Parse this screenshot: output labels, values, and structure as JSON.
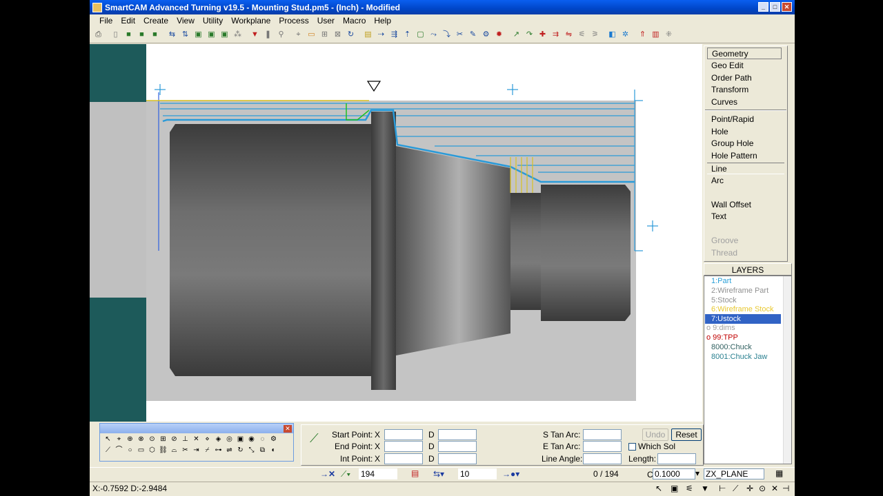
{
  "window": {
    "title": "SmartCAM Advanced Turning v19.5 - Mounting Stud.pm5 - (Inch) - Modified",
    "min": "_",
    "max": "□",
    "close": "✕"
  },
  "menu": [
    "File",
    "Edit",
    "Create",
    "View",
    "Utility",
    "Workplane",
    "Process",
    "User",
    "Macro",
    "Help"
  ],
  "commands": {
    "group1": [
      "Geometry",
      "Geo Edit",
      "Order Path",
      "Transform",
      "Curves"
    ],
    "group2": [
      "Point/Rapid",
      "Hole",
      "Group Hole",
      "Hole Pattern",
      "Line",
      "Arc"
    ],
    "group3": [
      "Wall Offset",
      "Text"
    ],
    "group4": [
      "Groove",
      "Thread"
    ]
  },
  "layers": {
    "header": "LAYERS",
    "items": [
      {
        "label": "1:Part",
        "color": "#2aa0d8"
      },
      {
        "label": "2:Wireframe Part",
        "color": "#909090"
      },
      {
        "label": "5:Stock",
        "color": "#909090"
      },
      {
        "label": "6:Wireframe Stock",
        "color": "#e8c830"
      },
      {
        "label": "7:Ustock",
        "color": "#ffffff",
        "selected": true
      },
      {
        "label": "o 9:dims",
        "color": "#a0a0a0"
      },
      {
        "label": "o 99:TPP",
        "color": "#c00000"
      },
      {
        "label": "8000:Chuck",
        "color": "#306060"
      },
      {
        "label": "8001:Chuck Jaw",
        "color": "#2a8090"
      }
    ]
  },
  "form": {
    "start_point": "Start Point:",
    "end_point": "End Point:",
    "int_point": "Int Point:",
    "x": "X",
    "d": "D",
    "s_tan_arc": "S Tan Arc:",
    "e_tan_arc": "E Tan Arc:",
    "line_angle": "Line Angle:",
    "which_sol": "Which Sol",
    "length": "Length:",
    "undo": "Undo",
    "reset": "Reset"
  },
  "bottom": {
    "step_value": "194",
    "count_value": "10",
    "counter": "0 / 194",
    "c_label": "C",
    "c_value": "0.1000",
    "plane": "ZX_PLANE"
  },
  "status": {
    "coords": "X:-0.7592  D:-2.9484"
  },
  "colors": {
    "toolpath": "#2a9ad8",
    "stock_yellow": "#d8c020",
    "green": "#20c020",
    "chuck": "#1d5a5a"
  }
}
